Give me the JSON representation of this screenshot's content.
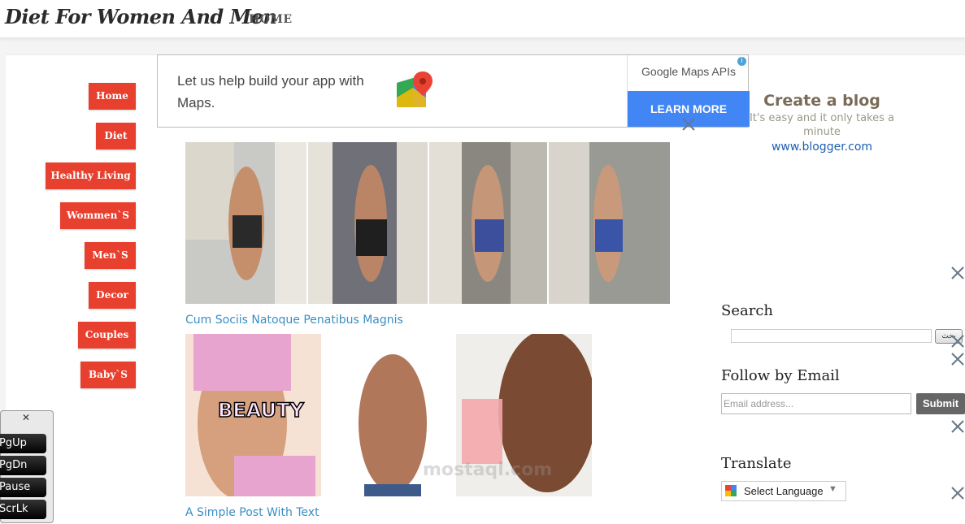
{
  "header": {
    "site_title": "Diet For Women And Men",
    "nav_home": "HOME"
  },
  "menu": [
    "Home",
    "Diet",
    "Healthy Living",
    "Wommen`S",
    "Men`S",
    "Decor",
    "Couples",
    "Baby`S"
  ],
  "ad": {
    "text": "Let us help build your app with Maps.",
    "brand": "Google Maps APIs",
    "cta": "LEARN MORE",
    "info": "i"
  },
  "posts": [
    {
      "title": "Cum Sociis Natoque Penatibus Magnis"
    },
    {
      "title": "A Simple Post With Text"
    }
  ],
  "photo_labels": {
    "beauty": "BEAUTY"
  },
  "sidebar": {
    "create_blog": {
      "title": "Create a blog",
      "subtitle": "It's easy and it only takes a minute",
      "url": "www.blogger.com"
    },
    "search": {
      "heading": "Search",
      "button": "بحث"
    },
    "follow": {
      "heading": "Follow by Email",
      "placeholder": "Email address...",
      "button": "Submit"
    },
    "translate": {
      "heading": "Translate",
      "select_value": "Select Language"
    }
  },
  "keypad": {
    "keys": [
      "PgUp",
      "PgDn",
      "Pause",
      "ScrLk"
    ]
  },
  "watermark": "mostaql.com",
  "colors": {
    "accent": "#e8402f",
    "link": "#3a8ec4",
    "ad_cta": "#4285f4"
  }
}
